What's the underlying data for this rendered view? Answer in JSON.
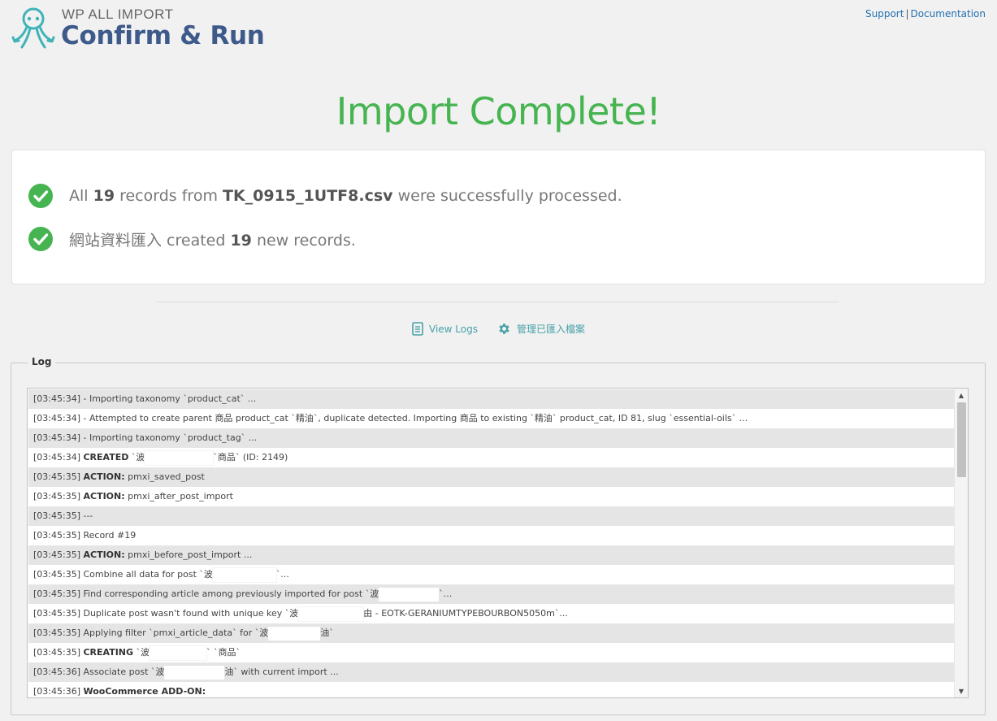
{
  "header": {
    "brand_small": "WP ALL IMPORT",
    "brand_title": "Confirm & Run",
    "support_label": "Support",
    "separator": "|",
    "docs_label": "Documentation"
  },
  "colors": {
    "success_green": "#46b450",
    "brand_blue": "#3d5a8a",
    "logo_teal": "#3fb3b8",
    "link_blue": "#2271b1"
  },
  "main": {
    "title": "Import Complete!",
    "line1": {
      "pre": "All ",
      "count": "19",
      "mid": " records from ",
      "file": "TK_0915_1UTF8.csv",
      "post": " were successfully processed."
    },
    "line2": {
      "pre": "網站資料匯入 created ",
      "count": "19",
      "post": " new records."
    }
  },
  "actions": {
    "view_logs": "View Logs",
    "manage": "管理已匯入檔案"
  },
  "log": {
    "legend": "Log",
    "rows": [
      {
        "pre": "[03:45:34] - Importing taxonomy `product_cat` ..."
      },
      {
        "pre": "[03:45:34] - Attempted to create parent 商品 product_cat `精油`, duplicate detected. Importing 商品 to existing `精油` product_cat, ID 81, slug `essential-oils` ..."
      },
      {
        "pre": "[03:45:34] - Importing taxonomy `product_tag` ..."
      },
      {
        "pre": "[03:45:34] ",
        "bold": "CREATED",
        "mid": " `波",
        "post": "`商品` (ID: 2149)"
      },
      {
        "pre": "[03:45:35] ",
        "bold": "ACTION:",
        "post": " pmxi_saved_post"
      },
      {
        "pre": "[03:45:35] ",
        "bold": "ACTION:",
        "post": " pmxi_after_post_import"
      },
      {
        "pre": "[03:45:35] ---"
      },
      {
        "pre": "[03:45:35] Record #19"
      },
      {
        "pre": "[03:45:35] ",
        "bold": "ACTION:",
        "post": " pmxi_before_post_import ..."
      },
      {
        "pre": "[03:45:35] Combine all data for post `波",
        "post": "`..."
      },
      {
        "pre": "[03:45:35] Find corresponding article among previously imported for post `波",
        "post": "`..."
      },
      {
        "pre": "[03:45:35] Duplicate post wasn't found with unique key `波",
        "post": "由 - EOTK-GERANIUMTYPEBOURBON5050m`..."
      },
      {
        "pre": "[03:45:35] Applying filter `pmxi_article_data` for `波",
        "post": "油`"
      },
      {
        "pre": "[03:45:35] ",
        "bold": "CREATING",
        "mid": " `波",
        "post": "` `商品`"
      },
      {
        "pre": "[03:45:36] Associate post `波",
        "post": "油` with current import ..."
      },
      {
        "pre": "[03:45:36] ",
        "bold": "WooCommerce ADD-ON:"
      }
    ]
  }
}
